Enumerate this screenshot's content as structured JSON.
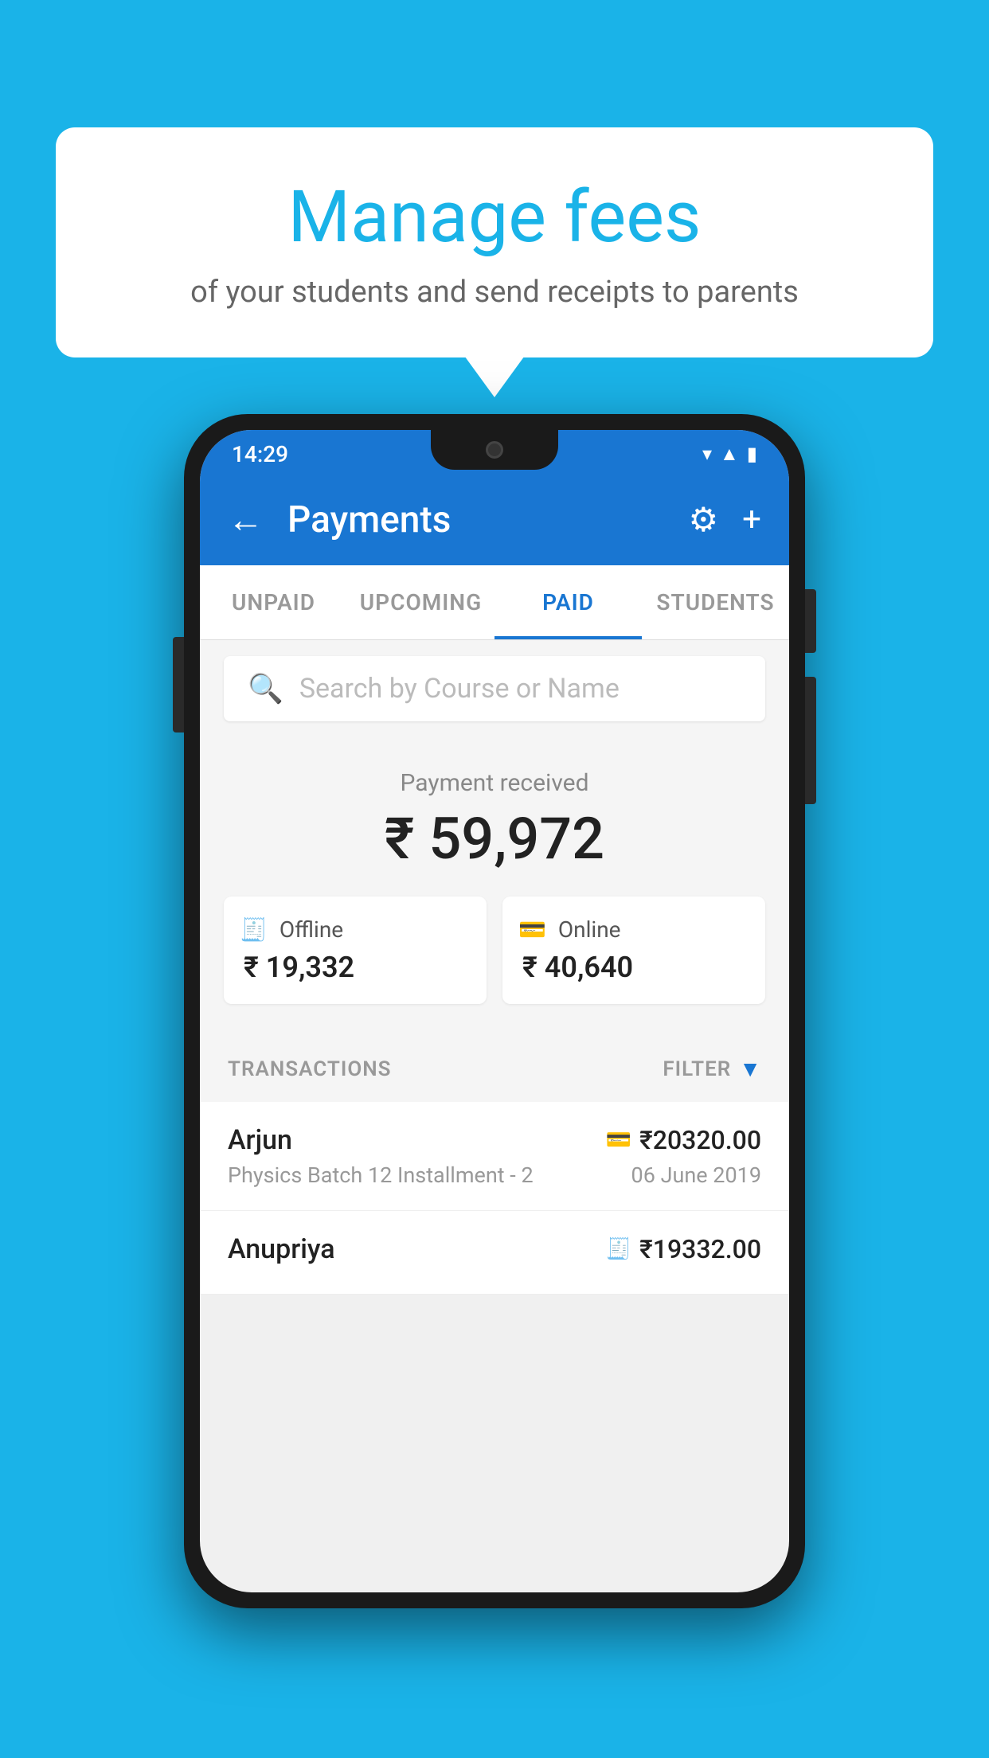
{
  "background_color": "#1ab3e8",
  "speech_bubble": {
    "title": "Manage fees",
    "subtitle": "of your students and send receipts to parents"
  },
  "phone": {
    "status_bar": {
      "time": "14:29",
      "icons": [
        "wifi",
        "signal",
        "battery"
      ]
    },
    "app_bar": {
      "title": "Payments",
      "back_label": "←",
      "gear_label": "⚙",
      "plus_label": "+"
    },
    "tabs": [
      {
        "label": "UNPAID",
        "active": false
      },
      {
        "label": "UPCOMING",
        "active": false
      },
      {
        "label": "PAID",
        "active": true
      },
      {
        "label": "STUDENTS",
        "active": false
      }
    ],
    "search": {
      "placeholder": "Search by Course or Name"
    },
    "payment": {
      "label": "Payment received",
      "amount": "₹ 59,972",
      "cards": [
        {
          "type": "Offline",
          "icon": "💳",
          "amount": "₹ 19,332"
        },
        {
          "type": "Online",
          "icon": "💳",
          "amount": "₹ 40,640"
        }
      ]
    },
    "transactions": {
      "header_label": "TRANSACTIONS",
      "filter_label": "FILTER",
      "rows": [
        {
          "name": "Arjun",
          "course": "Physics Batch 12 Installment - 2",
          "amount": "₹20320.00",
          "date": "06 June 2019",
          "icon": "💳"
        },
        {
          "name": "Anupriya",
          "course": "",
          "amount": "₹19332.00",
          "date": "",
          "icon": "💵"
        }
      ]
    }
  }
}
